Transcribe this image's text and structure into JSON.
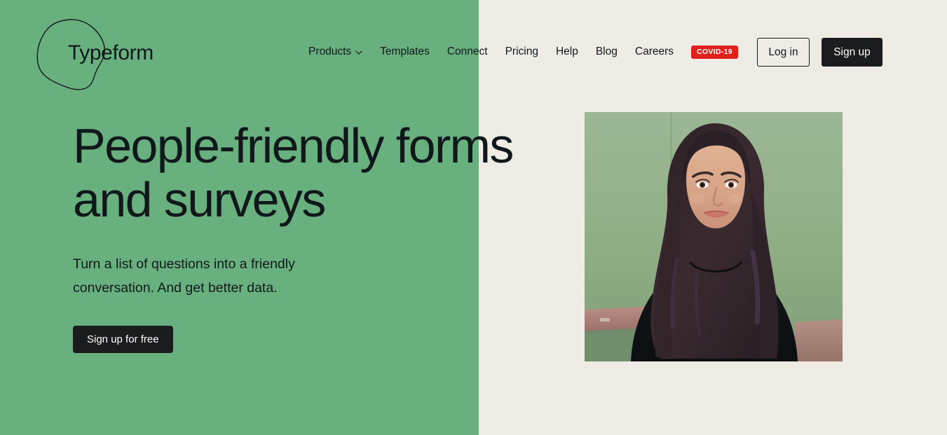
{
  "brand": {
    "name": "Typeform",
    "logo_icon": "blob-outline-icon"
  },
  "colors": {
    "green_panel": "#68b17e",
    "cream_background": "#efece6",
    "dark": "#1b1c1e",
    "covid_red": "#e0201b",
    "white": "#ffffff"
  },
  "nav": {
    "items": [
      {
        "label": "Products",
        "has_dropdown": true,
        "icon": "chevron-down-icon"
      },
      {
        "label": "Templates",
        "has_dropdown": false
      },
      {
        "label": "Connect",
        "has_dropdown": false
      },
      {
        "label": "Pricing",
        "has_dropdown": false
      },
      {
        "label": "Help",
        "has_dropdown": false
      },
      {
        "label": "Blog",
        "has_dropdown": false
      },
      {
        "label": "Careers",
        "has_dropdown": false
      }
    ],
    "badge": "COVID-19"
  },
  "auth": {
    "login_label": "Log in",
    "signup_label": "Sign up"
  },
  "hero": {
    "headline": "People-friendly forms\nand surveys",
    "subhead": "Turn a list of questions into a friendly\nconversation. And get better data.",
    "cta_label": "Sign up for free",
    "image_alt": "Smiling woman with long dark hair in a black sweater in front of a green wall"
  }
}
